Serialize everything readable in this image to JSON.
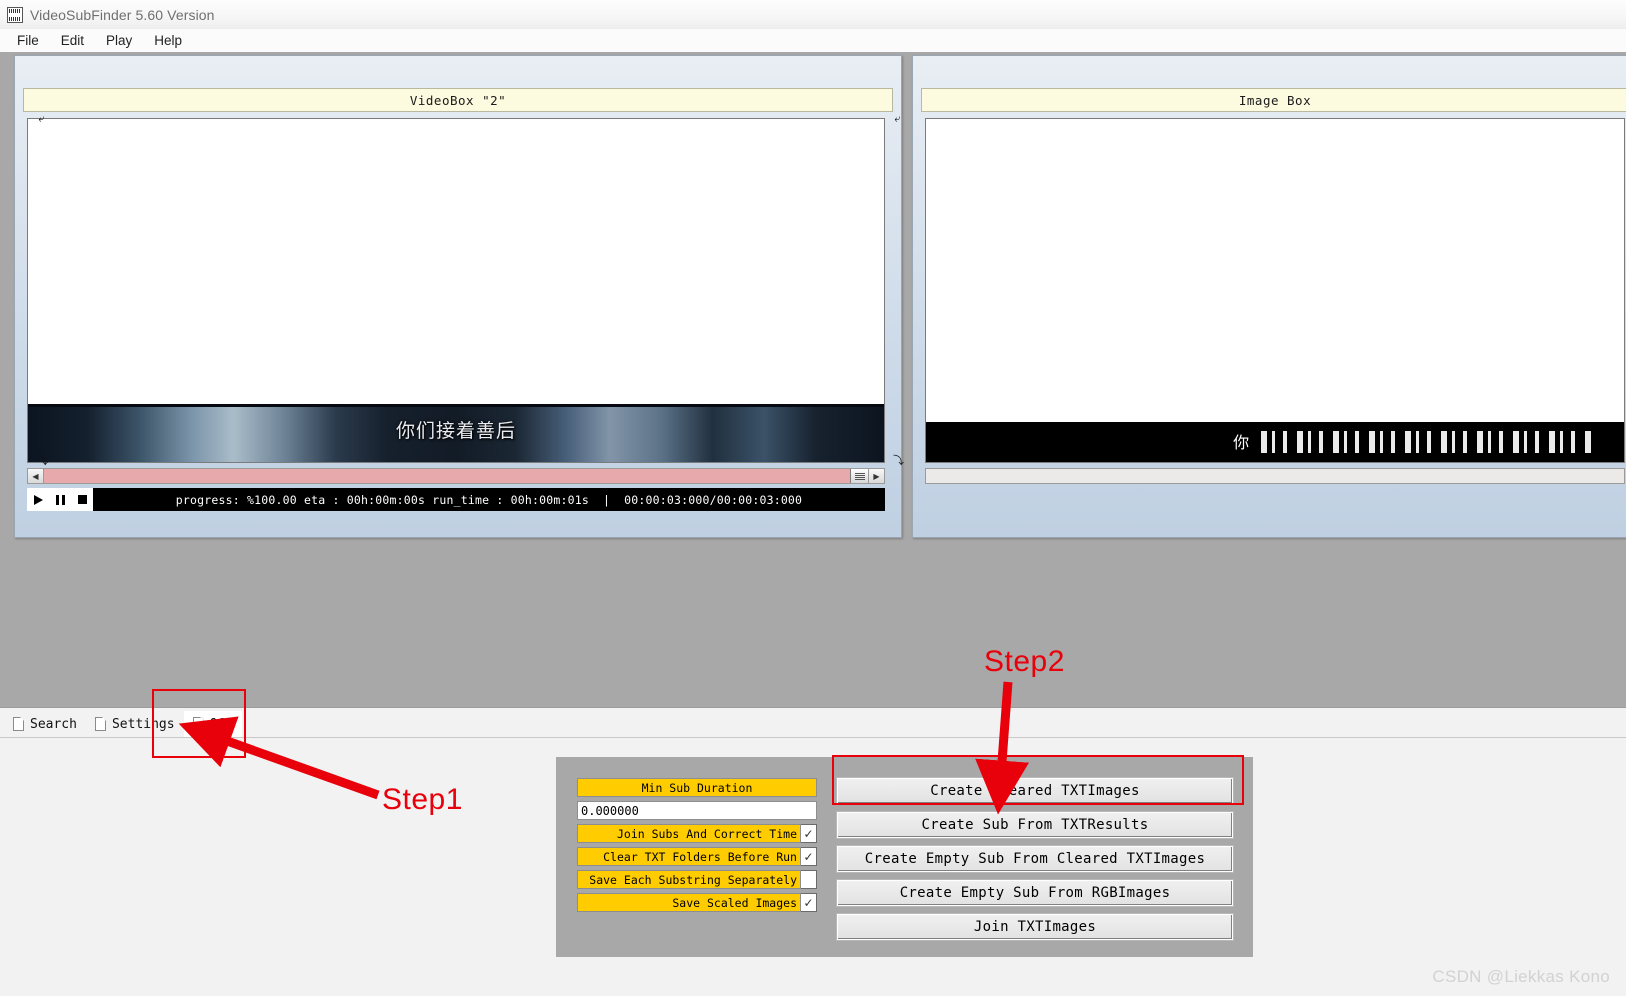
{
  "window": {
    "title": "VideoSubFinder 5.60 Version",
    "icon": "app-film-icon"
  },
  "menu": {
    "items": [
      {
        "label": "File"
      },
      {
        "label": "Edit"
      },
      {
        "label": "Play"
      },
      {
        "label": "Help"
      }
    ]
  },
  "video_panel": {
    "title": "VideoBox \"2\"",
    "subtitle_text": "你们接着善后",
    "transport": {
      "play": "play-icon",
      "pause": "pause-icon",
      "stop": "stop-icon"
    },
    "status": {
      "progress": "progress: %100.00 eta : 00h:00m:00s run_time : 00h:00m:01s",
      "separator": "|",
      "time": "00:00:03:000/00:00:03:000"
    }
  },
  "image_panel": {
    "title": "Image Box",
    "subtitle_fragment": "你"
  },
  "tabs": [
    {
      "label": "Search",
      "active": false
    },
    {
      "label": "Settings",
      "active": false
    },
    {
      "label": "OCR",
      "active": true
    }
  ],
  "ocr": {
    "options": [
      {
        "label": "Min Sub Duration",
        "type": "header",
        "align": "center"
      },
      {
        "label": "0.000000",
        "type": "input"
      },
      {
        "label": "Join Subs And Correct Time",
        "type": "checkbox",
        "checked": true
      },
      {
        "label": "Clear TXT Folders Before Run",
        "type": "checkbox",
        "checked": true
      },
      {
        "label": "Save Each Substring Separately",
        "type": "checkbox",
        "checked": false
      },
      {
        "label": "Save Scaled Images",
        "type": "checkbox",
        "checked": true
      }
    ],
    "buttons": [
      {
        "label": "Create Cleared TXTImages"
      },
      {
        "label": "Create Sub From TXTResults"
      },
      {
        "label": "Create Empty Sub From Cleared TXTImages"
      },
      {
        "label": "Create Empty Sub From RGBImages"
      },
      {
        "label": "Join TXTImages"
      }
    ]
  },
  "annotations": {
    "step1": "Step1",
    "step2": "Step2",
    "highlight_color": "#e8000b"
  },
  "watermark": "CSDN @Liekkas Kono"
}
